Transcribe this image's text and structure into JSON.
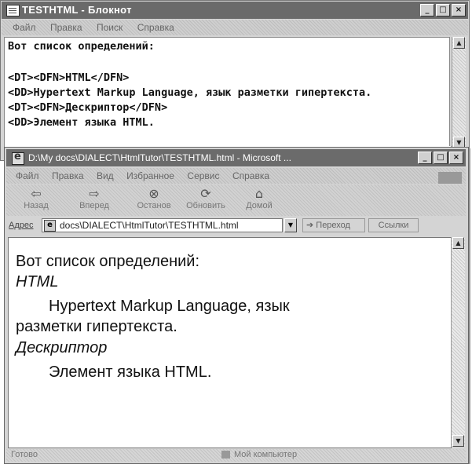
{
  "notepad": {
    "title": "TESTHTML - Блокнот",
    "menu": [
      "Файл",
      "Правка",
      "Поиск",
      "Справка"
    ],
    "lines": [
      "Вот список определений:",
      "",
      "<DT><DFN>HTML</DFN>",
      "<DD>Hypertext Markup Language, язык разметки гипертекста.",
      "<DT><DFN>Дескриптор</DFN>",
      "<DD>Элемент языка HTML."
    ]
  },
  "ie": {
    "title": "D:\\My docs\\DIALECT\\HtmlTutor\\TESTHTML.html - Microsoft ...",
    "menu": [
      "Файл",
      "Правка",
      "Вид",
      "Избранное",
      "Сервис",
      "Справка"
    ],
    "toolbar": [
      {
        "label": "Назад",
        "icon": "back-arrow-icon",
        "glyph": "⇦"
      },
      {
        "label": "Вперед",
        "icon": "forward-arrow-icon",
        "glyph": "⇨"
      },
      {
        "label": "Останов",
        "icon": "stop-icon",
        "glyph": "⊗"
      },
      {
        "label": "Обновить",
        "icon": "refresh-icon",
        "glyph": "⟳"
      },
      {
        "label": "Домой",
        "icon": "home-icon",
        "glyph": "⌂"
      }
    ],
    "address": {
      "label": "Адрес",
      "value": "docs\\DIALECT\\HtmlTutor\\TESTHTML.html",
      "go_label": "Переход",
      "links_label": "Ссылки"
    },
    "content": {
      "intro": "Вот список определений:",
      "term1": "HTML",
      "def1_line1": "Hypertext Markup Language, язык",
      "def1_line2": "разметки  гипертекста.",
      "term2": "Дескриптор",
      "def2": "Элемент языка  HTML."
    },
    "status": {
      "left": "Готово",
      "zone": "Мой компьютер"
    }
  }
}
